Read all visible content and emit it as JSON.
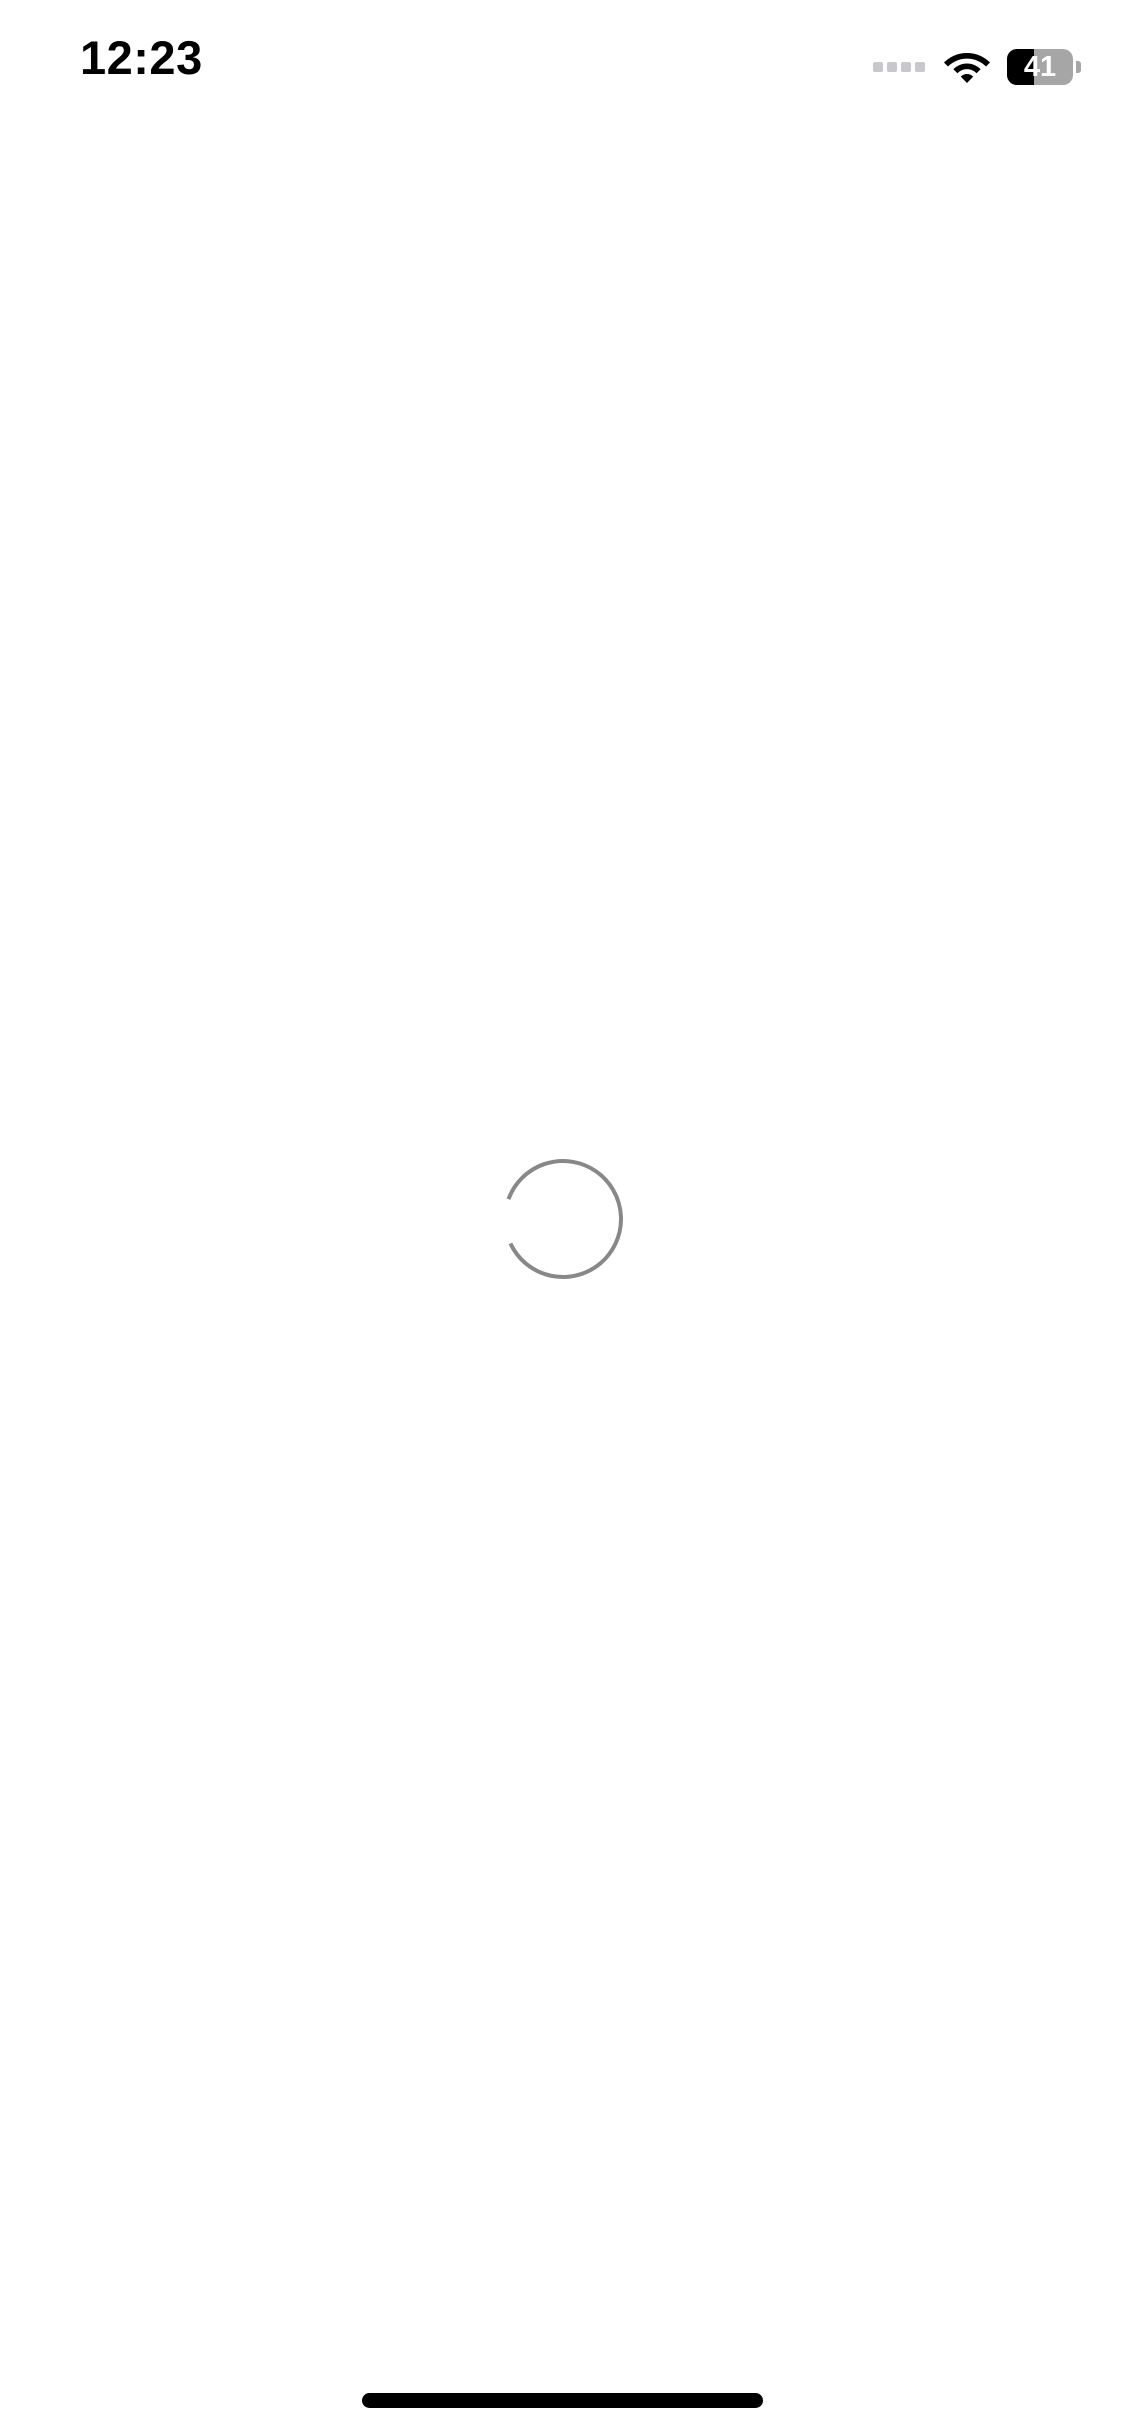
{
  "status_bar": {
    "time": "12:23",
    "battery_level": "41",
    "battery_fraction": 0.41,
    "signal_bars_active": 0,
    "signal_bars_total": 4,
    "icons": [
      "cellular-signal-icon",
      "wifi-icon",
      "battery-icon"
    ]
  },
  "loading": {
    "icon": "loading-spinner-icon",
    "arc_fraction": 0.875
  },
  "colors": {
    "background": "#ffffff",
    "text": "#000000",
    "spinner": "#888888",
    "signal_inactive": "#c7c7cc",
    "battery_fill": "#000000",
    "battery_empty": "#a6a6a6",
    "home_indicator": "#000000"
  }
}
